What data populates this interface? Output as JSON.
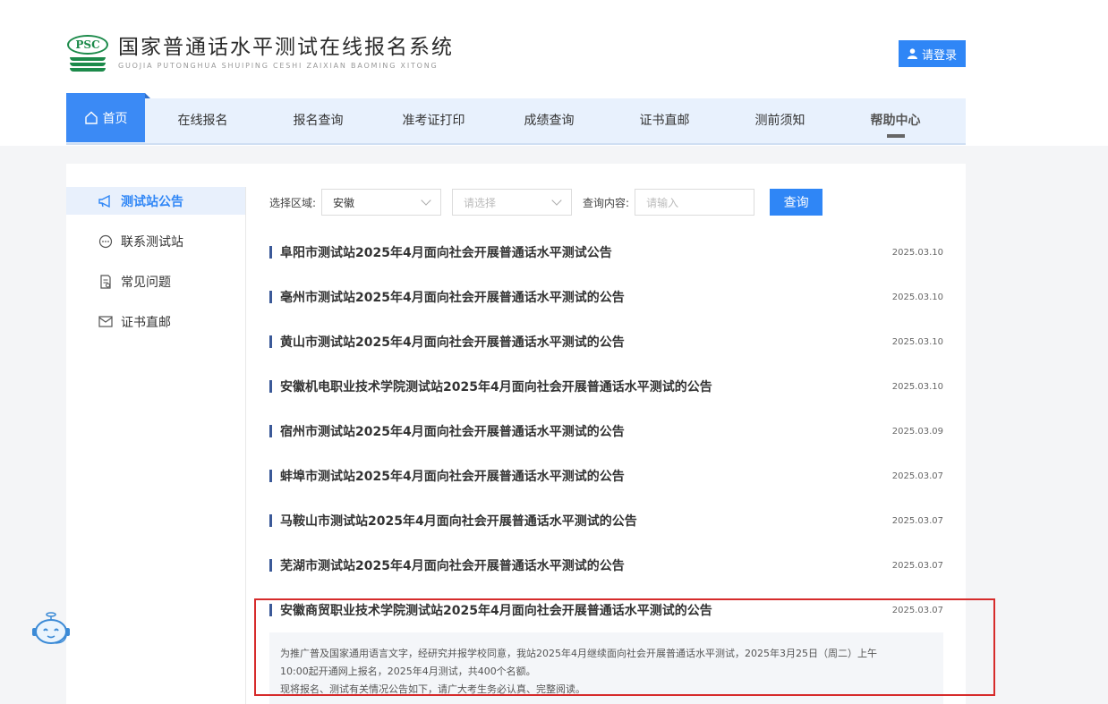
{
  "header": {
    "logo_badge": "PSC",
    "title": "国家普通话水平测试在线报名系统",
    "subtitle": "GUOJIA PUTONGHUA SHUIPING CESHI ZAIXIAN BAOMING XITONG",
    "login_label": "请登录"
  },
  "nav": {
    "home": "首页",
    "items": [
      "在线报名",
      "报名查询",
      "准考证打印",
      "成绩查询",
      "证书直邮",
      "测前须知",
      "帮助中心"
    ]
  },
  "sidebar": {
    "items": [
      {
        "label": "测试站公告",
        "icon": "megaphone-icon"
      },
      {
        "label": "联系测试站",
        "icon": "chat-icon"
      },
      {
        "label": "常见问题",
        "icon": "document-icon"
      },
      {
        "label": "证书直邮",
        "icon": "mail-icon"
      }
    ]
  },
  "filters": {
    "region_label": "选择区域:",
    "region_value": "安徽",
    "sub_placeholder": "请选择",
    "content_label": "查询内容:",
    "content_placeholder": "请输入",
    "query_button": "查询"
  },
  "notices": [
    {
      "title": "阜阳市测试站2025年4月面向社会开展普通话水平测试公告",
      "date": "2025.03.10"
    },
    {
      "title": "亳州市测试站2025年4月面向社会开展普通话水平测试的公告",
      "date": "2025.03.10"
    },
    {
      "title": "黄山市测试站2025年4月面向社会开展普通话水平测试的公告",
      "date": "2025.03.10"
    },
    {
      "title": "安徽机电职业技术学院测试站2025年4月面向社会开展普通话水平测试的公告",
      "date": "2025.03.10"
    },
    {
      "title": "宿州市测试站2025年4月面向社会开展普通话水平测试的公告",
      "date": "2025.03.09"
    },
    {
      "title": "蚌埠市测试站2025年4月面向社会开展普通话水平测试的公告",
      "date": "2025.03.07"
    },
    {
      "title": "马鞍山市测试站2025年4月面向社会开展普通话水平测试的公告",
      "date": "2025.03.07"
    },
    {
      "title": "芜湖市测试站2025年4月面向社会开展普通话水平测试的公告",
      "date": "2025.03.07"
    },
    {
      "title": "安徽商贸职业技术学院测试站2025年4月面向社会开展普通话水平测试的公告",
      "date": "2025.03.07"
    }
  ],
  "summary": {
    "line1": "为推广普及国家通用语言文字，经研究并报学校同意，我站2025年4月继续面向社会开展普通话水平测试，2025年3月25日（周二）上午",
    "line2": "10:00起开通网上报名，2025年4月测试，共400个名额。",
    "line3": "现将报名、测试有关情况公告如下，请广大考生务必认真、完整阅读。"
  },
  "colors": {
    "accent": "#2f86f6",
    "highlight": "#d62b2b",
    "brand_green": "#1c8a4a"
  }
}
